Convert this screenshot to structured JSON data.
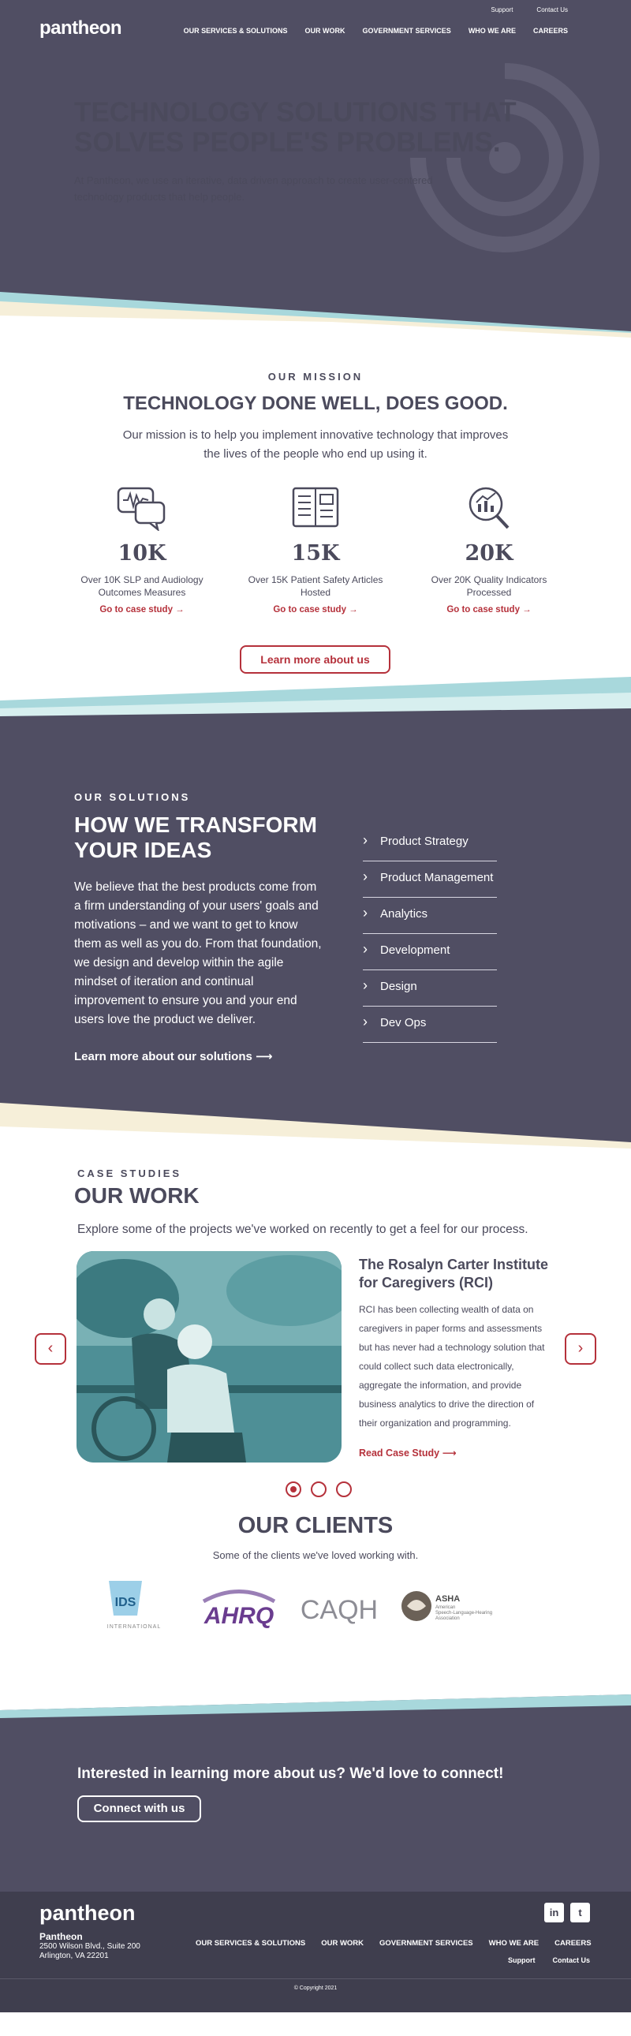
{
  "header": {
    "logo": "pantheon",
    "top_links": [
      "Support",
      "Contact Us"
    ],
    "nav": [
      "OUR SERVICES & SOLUTIONS",
      "OUR WORK",
      "GOVERNMENT SERVICES",
      "WHO WE ARE",
      "CAREERS"
    ]
  },
  "hero": {
    "title": "TECHNOLOGY SOLUTIONS THAT SOLVES PEOPLE'S PROBLEMS.",
    "subtitle": "At Pantheon, we use an iterative, data driven approach to create user-centered technology products that help people."
  },
  "mission": {
    "eyebrow": "OUR MISSION",
    "title": "TECHNOLOGY DONE WELL, DOES GOOD.",
    "lead": "Our mission is to help you implement innovative technology that improves the lives of the people who end up using it.",
    "stats": [
      {
        "icon": "speech-waveform-icon",
        "number": "10K",
        "desc": "Over 10K SLP and Audiology Outcomes Measures",
        "link": "Go to case study →"
      },
      {
        "icon": "newspaper-icon",
        "number": "15K",
        "desc": "Over 15K Patient Safety Articles Hosted",
        "link": "Go to case study →"
      },
      {
        "icon": "magnifier-chart-icon",
        "number": "20K",
        "desc": "Over 20K Quality Indicators Processed",
        "link": "Go to case study →"
      }
    ],
    "button": "Learn more about us"
  },
  "solutions": {
    "eyebrow": "OUR SOLUTIONS",
    "title": "HOW WE TRANSFORM YOUR IDEAS",
    "body": "We believe that the best products come from a firm understanding of your users' goals and motivations – and we want to get to know them as well as you do. From that foundation, we design and develop within the agile mindset of iteration and continual improvement to ensure you and your end users love the product we deliver.",
    "cta": "Learn more about our solutions",
    "list": [
      "Product Strategy",
      "Product Management",
      "Analytics",
      "Development",
      "Design",
      "Dev Ops"
    ]
  },
  "cases": {
    "eyebrow": "CASE STUDIES",
    "title": "OUR WORK",
    "lead": "Explore some of the projects we've worked on recently to get a feel for our process.",
    "case_title": "The Rosalyn Carter Institute for Caregivers (RCI)",
    "case_body": "RCI has been collecting wealth of data on caregivers in paper forms and assessments but has never had a technology solution that could collect such data electronically, aggregate the information, and provide business analytics to drive the direction of their organization and programming.",
    "case_link": "Read Case Study",
    "prev": "‹",
    "next": "›"
  },
  "clients": {
    "title": "OUR CLIENTS",
    "lead": "Some of the clients we've loved working with.",
    "logos": [
      "IDS",
      "INTERNATIONAL",
      "AHRQ",
      "CAQH",
      "ASHA",
      "American",
      "Speech-Language-Hearing",
      "Association"
    ]
  },
  "connect": {
    "title": "Interested in learning more about us? We'd love to connect!",
    "button": "Connect with us"
  },
  "footer": {
    "logo": "pantheon",
    "company": "Pantheon",
    "address1": "2500 Wilson Blvd., Suite 200",
    "address2": "Arlington, VA 22201",
    "nav": [
      "OUR SERVICES & SOLUTIONS",
      "OUR WORK",
      "GOVERNMENT SERVICES",
      "WHO WE ARE",
      "CAREERS"
    ],
    "sub": [
      "Support",
      "Contact Us"
    ],
    "social": [
      "in",
      "t"
    ],
    "copyright": "© Copyright 2021"
  },
  "colors": {
    "dark": "#504e63",
    "accent": "#b5313b",
    "teal": "#a8d8dc",
    "cream": "#f6efd9",
    "footer": "#3f3e4e"
  }
}
